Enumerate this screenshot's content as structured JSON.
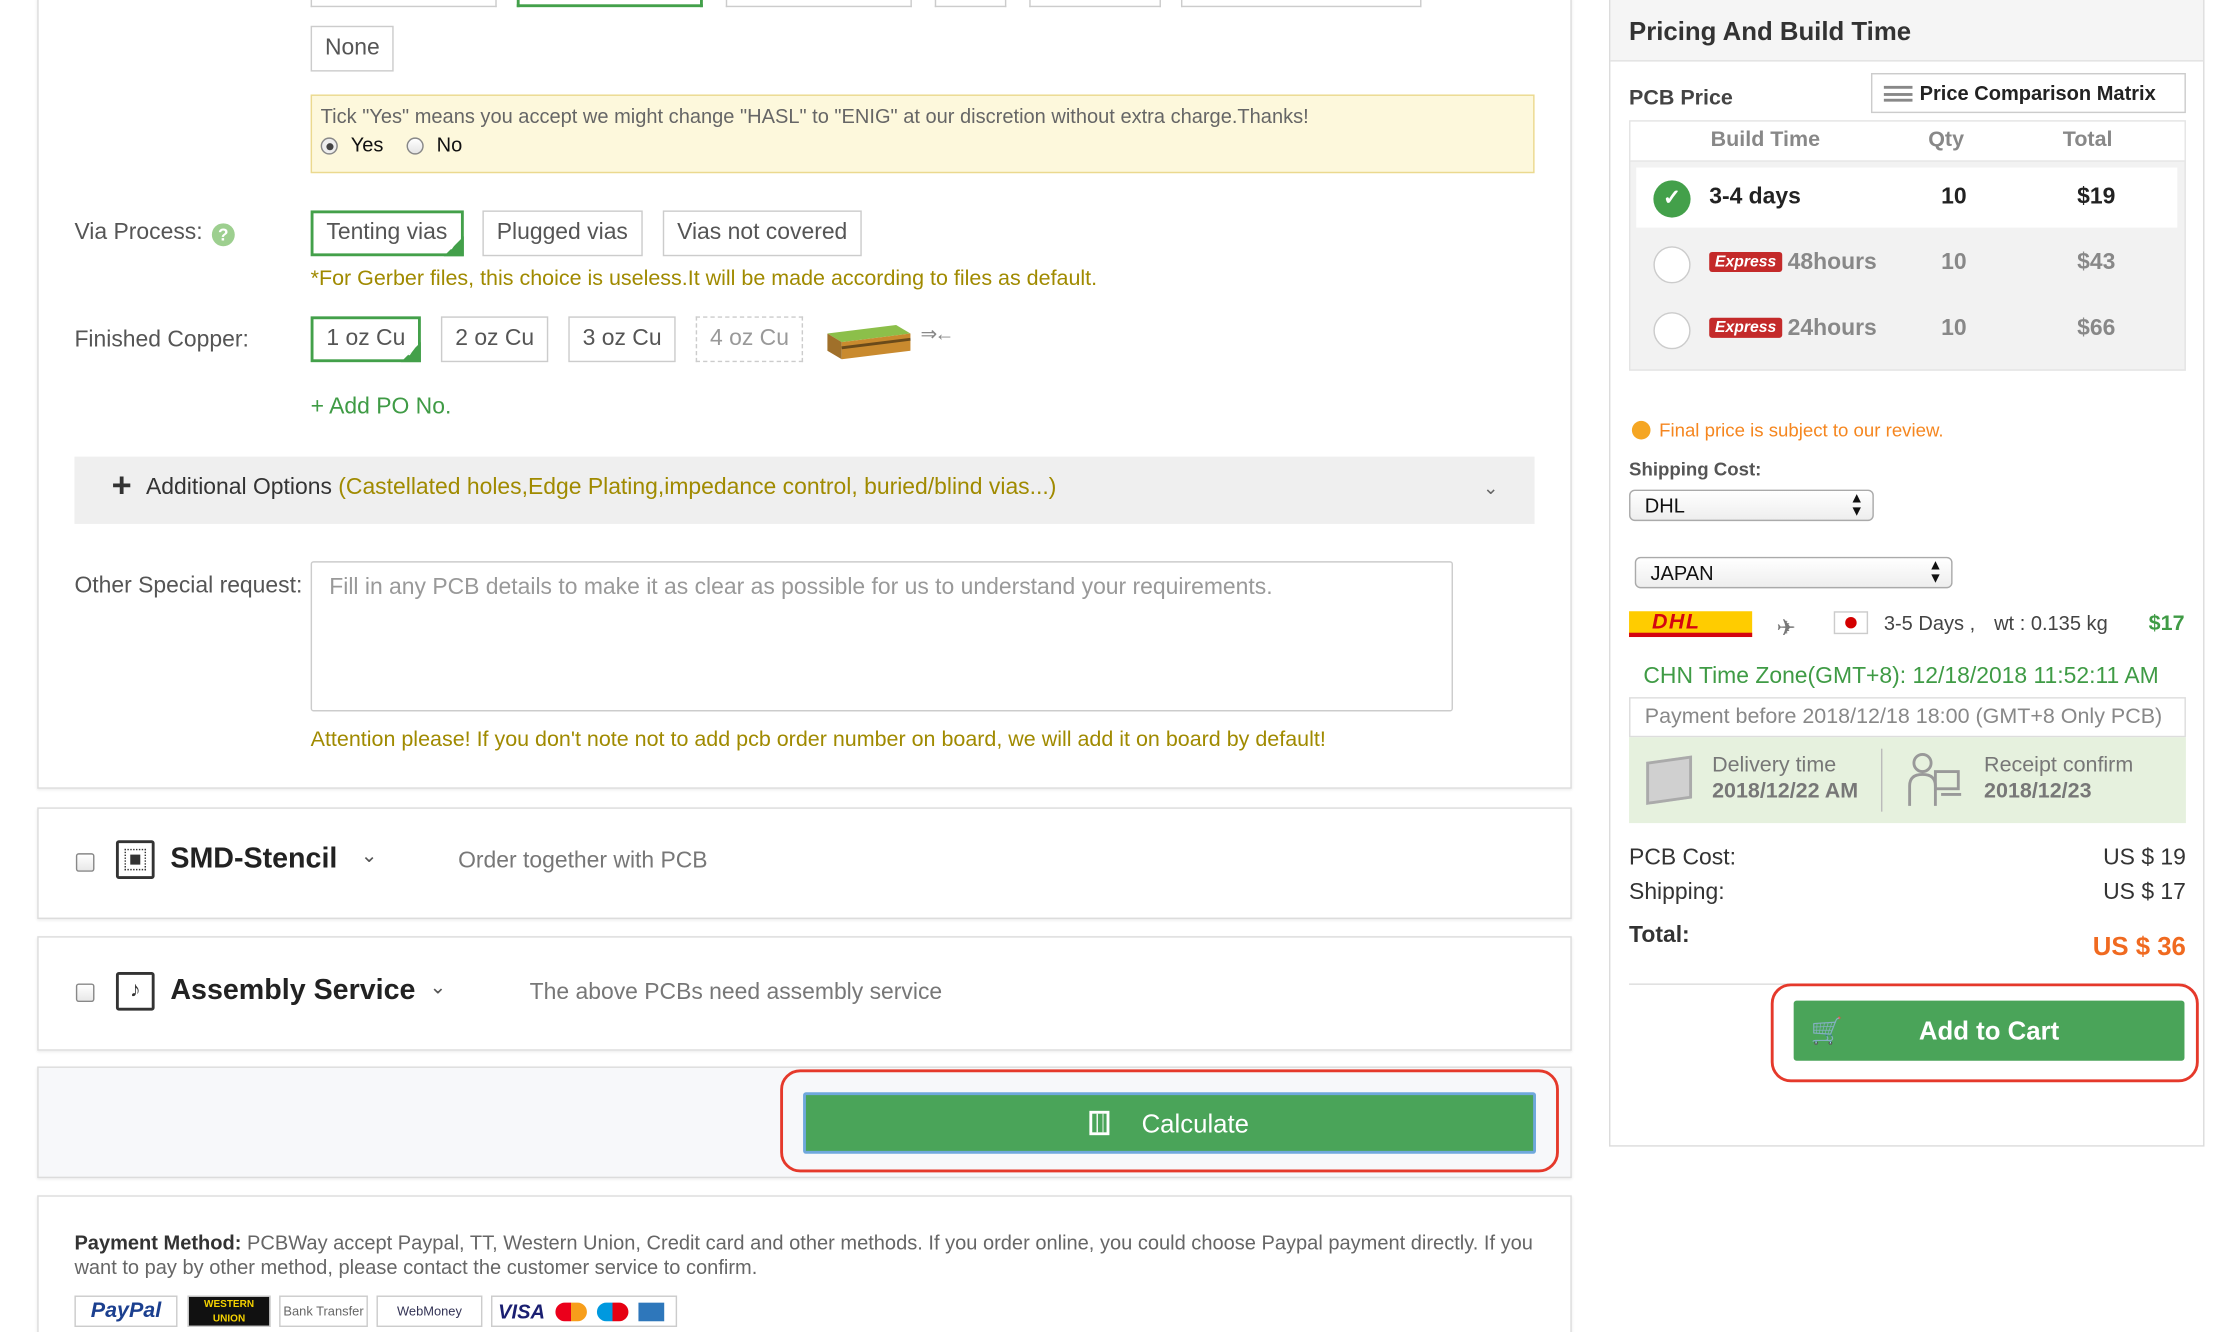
{
  "form": {
    "none_option": "None",
    "enig_notice": {
      "text": "Tick \"Yes\" means you accept we might change \"HASL\" to \"ENIG\" at our discretion without extra charge.Thanks!",
      "yes": "Yes",
      "no": "No",
      "selected": "Yes"
    },
    "via_process": {
      "label": "Via Process:",
      "options": [
        "Tenting vias",
        "Plugged vias",
        "Vias not covered"
      ],
      "selected": "Tenting vias",
      "note": "*For Gerber files, this choice is useless.It will be made according to files as default."
    },
    "finished_copper": {
      "label": "Finished Copper:",
      "options": [
        "1 oz Cu",
        "2 oz Cu",
        "3 oz Cu",
        "4 oz Cu"
      ],
      "selected": "1 oz Cu",
      "arrow": "⇒←"
    },
    "add_po": "+ Add PO No.",
    "additional_options": {
      "plus": "+",
      "label": "Additional Options",
      "detail": "(Castellated holes,Edge Plating,impedance control, buried/blind vias...)"
    },
    "special_request": {
      "label": "Other Special request:",
      "placeholder": "Fill in any PCB details to make it as clear as possible for us to understand your requirements.",
      "attention": "Attention please! If you don't note not to add pcb order number on board, we will add it on board by default!"
    }
  },
  "services": {
    "smd": {
      "title": "SMD-Stencil",
      "desc": "Order together with PCB"
    },
    "assembly": {
      "title": "Assembly Service",
      "desc": "The above PCBs need assembly service"
    }
  },
  "calculate_label": "Calculate",
  "payment": {
    "label": "Payment Method:",
    "text": "PCBWay accept Paypal, TT, Western Union, Credit card and other methods. If you order online, you could choose Paypal payment directly. If you want to pay by other method, please contact the customer service to confirm.",
    "logos": [
      "PayPal",
      "WESTERN UNION",
      "Bank Transfer",
      "WebMoney",
      "VISA"
    ]
  },
  "sidebar": {
    "title": "Pricing And Build Time",
    "pcb_price": "PCB Price",
    "comparison_matrix": "Price Comparison Matrix",
    "table": {
      "headers": [
        "Build Time",
        "Qty",
        "Total"
      ],
      "rows": [
        {
          "express": "",
          "time": "3-4 days",
          "qty": "10",
          "total": "$19",
          "selected": true
        },
        {
          "express": "Express",
          "time": "48hours",
          "qty": "10",
          "total": "$43",
          "selected": false
        },
        {
          "express": "Express",
          "time": "24hours",
          "qty": "10",
          "total": "$66",
          "selected": false
        }
      ]
    },
    "final_price_note": "Final price is subject to our review.",
    "shipping_cost_label": "Shipping Cost:",
    "carrier": "DHL",
    "country": "JAPAN",
    "shipping_days": "3-5 Days ,",
    "weight": "wt : 0.135 kg",
    "shipping_price": "$17",
    "dhl_logo": "DHL",
    "time_zone": "CHN Time Zone(GMT+8): 12/18/2018 11:52:11 AM",
    "payment_before": "Payment before 2018/12/18 18:00 (GMT+8 Only PCB)",
    "delivery": {
      "label": "Delivery time",
      "date": "2018/12/22 AM"
    },
    "receipt": {
      "label": "Receipt confirm",
      "date": "2018/12/23"
    },
    "pcb_cost_label": "PCB Cost:",
    "pcb_cost": "US $ 19",
    "shipping_label": "Shipping:",
    "shipping": "US $ 17",
    "total_label": "Total:",
    "total": "US $ 36",
    "add_to_cart": "Add to Cart"
  },
  "colors": {
    "accent": "#4aa459",
    "total": "#f06a20",
    "notice": "#a08a00",
    "highlight_ring": "#e5392b"
  }
}
